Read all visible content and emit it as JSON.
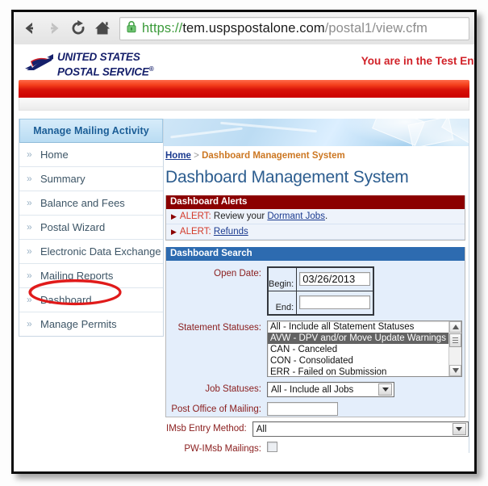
{
  "browser": {
    "back_icon": "back-arrow-icon",
    "forward_icon": "forward-arrow-icon",
    "reload_icon": "reload-icon",
    "home_icon": "home-icon",
    "lock_icon": "padlock-icon",
    "url_scheme": "https://",
    "url_host": "tem.uspspostalone.com",
    "url_path": "/postal1/view.cfm",
    "url_full": "https://tem.uspspostalone.com/postal1/view.cfm"
  },
  "site_header": {
    "logo_line1": "UNITED STATES",
    "logo_line2": "POSTAL SERVICE",
    "logo_reg": "®",
    "test_env_notice": "You are in the Test Env"
  },
  "sidebar": {
    "title": "Manage Mailing Activity",
    "chevron": "»",
    "items": [
      {
        "label": "Home"
      },
      {
        "label": "Summary"
      },
      {
        "label": "Balance and Fees"
      },
      {
        "label": "Postal Wizard"
      },
      {
        "label": "Electronic Data Exchange"
      },
      {
        "label": "Mailing Reports"
      },
      {
        "label": "Dashboard"
      },
      {
        "label": "Manage Permits"
      }
    ],
    "annotation": {
      "shape": "red-ellipse",
      "target": "Dashboard",
      "color": "#e01b1b"
    }
  },
  "main": {
    "breadcrumb_home": "Home",
    "breadcrumb_sep": ">",
    "breadcrumb_current": "Dashboard Management System",
    "page_title": "Dashboard Management System",
    "alerts_panel": {
      "heading": "Dashboard Alerts",
      "rows": [
        {
          "prefix": "ALERT:",
          "text": "Review your ",
          "link": "Dormant Jobs",
          "suffix": "."
        },
        {
          "prefix": "ALERT:",
          "text": "",
          "link": "Refunds",
          "suffix": ""
        }
      ]
    },
    "search_panel": {
      "heading": "Dashboard Search",
      "open_date_label": "Open Date:",
      "begin_label": "Begin:",
      "begin_value": "03/26/2013",
      "end_label": "End:",
      "end_value": "",
      "statement_statuses_label": "Statement Statuses:",
      "statement_statuses_options": [
        "All - Include all Statement Statuses",
        "AVW - DPV and/or Move Update Warnings",
        "CAN - Canceled",
        "CON - Consolidated",
        "ERR - Failed on Submission"
      ],
      "statement_statuses_selected_index": 1,
      "job_statuses_label": "Job Statuses:",
      "job_statuses_value": "All - Include all Jobs",
      "post_office_label": "Post Office of Mailing:",
      "post_office_value": "",
      "imsb_entry_label": "IMsb Entry Method:",
      "imsb_entry_value": "All",
      "pw_imsb_label": "PW-IMsb Mailings:",
      "pw_imsb_checked": false
    }
  },
  "colors": {
    "usps_blue": "#16206b",
    "usps_red": "#d12128",
    "alert_header": "#8b0000",
    "search_header": "#2d6bb0",
    "panel_bg": "#e4eefb",
    "label_text": "#8b2020",
    "link": "#1a3a8f",
    "annotation_red": "#e01b1b"
  }
}
